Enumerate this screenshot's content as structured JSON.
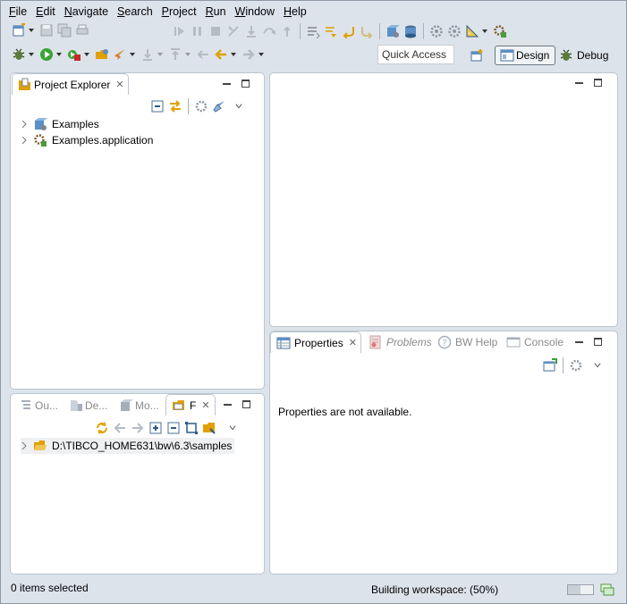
{
  "menu": [
    "File",
    "Edit",
    "Navigate",
    "Search",
    "Project",
    "Run",
    "Window",
    "Help"
  ],
  "quick_access": "Quick Access",
  "perspectives": {
    "design": "Design",
    "debug": "Debug"
  },
  "project_explorer": {
    "tab_label": "Project Explorer",
    "items": [
      "Examples",
      "Examples.application"
    ]
  },
  "bottom_left_tabs": [
    "Ou...",
    "De...",
    "Mo...",
    "F"
  ],
  "file_explorer": {
    "path": "D:\\TIBCO_HOME631\\bw\\6.3\\samples"
  },
  "properties": {
    "tabs": [
      "Properties",
      "Problems",
      "BW Help",
      "Console"
    ],
    "message": "Properties are not available."
  },
  "status": {
    "selection": "0 items selected",
    "progress_label": "Building workspace: (50%)",
    "progress": 0.5
  }
}
